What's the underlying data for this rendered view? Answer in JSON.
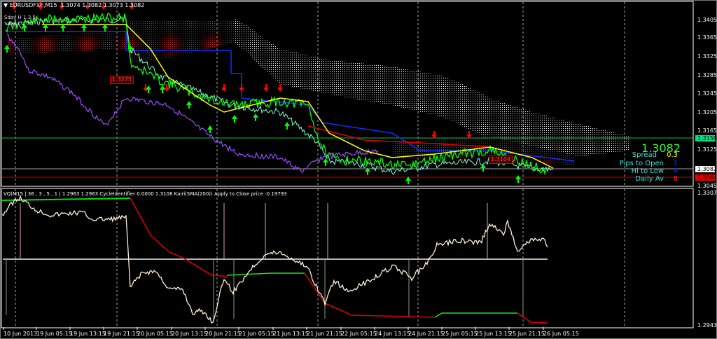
{
  "main_chart": {
    "title": "EURUSDFXF,M15",
    "ohlc": "1.3074 1.3082 1.3073 1.3082",
    "labels": {
      "sday_h": "Sday H 1.3.5",
      "sday_l": "Sday L 1.30"
    },
    "price_tag": "1.3275",
    "price_tag2": "1.3104",
    "price_axis": [
      "1.3405",
      "1.3365",
      "1.3325",
      "1.3285",
      "1.3245",
      "1.3205",
      "1.3165",
      "1.3125",
      "1.3045"
    ],
    "axis_markers": {
      "green": "1.3150",
      "current": "1.3082",
      "red": "1.3064"
    },
    "info_panel": {
      "price": "1.3082",
      "spread_label": "Spread",
      "spread_value": "0.3",
      "pips_label": "Pips to Open",
      "pips_value": "1",
      "hilo_label": "Hi to Low",
      "hilo_value": "4",
      "daily_label": "Daily Av",
      "daily_value": "8"
    }
  },
  "sub_chart": {
    "title": "VQ(M15 | 36 , 3 , 5 , 1 | 1.2963 1.2963  CycleIdentifier 0.0000 1.3108  Kairi(SMA(200)) Apply to Close price -0.19793",
    "axis_top": "1.3307",
    "axis_bottom": "1.2943"
  },
  "time_axis": [
    "10 Jun 2013",
    "19 Jun 05:15",
    "19 Jun 13:15",
    "19 Jun 21:15",
    "20 Jun 05:15",
    "20 Jun 13:15",
    "20 Jun 21:15",
    "21 Jun 05:15",
    "21 Jun 13:15",
    "21 Jun 21:15",
    "22 Jun 05:15",
    "24 Jun 13:15",
    "24 Jun 21:15",
    "25 Jun 05:15",
    "25 Jun 13:15",
    "25 Jun 21:15",
    "26 Jun 05:15"
  ],
  "colors": {
    "bull": "#00ff00",
    "bear": "#ff0000",
    "ma": "#ffff00",
    "purple": "#9b4dff",
    "blue": "#1030ff",
    "cyan": "#7fffd4"
  }
}
